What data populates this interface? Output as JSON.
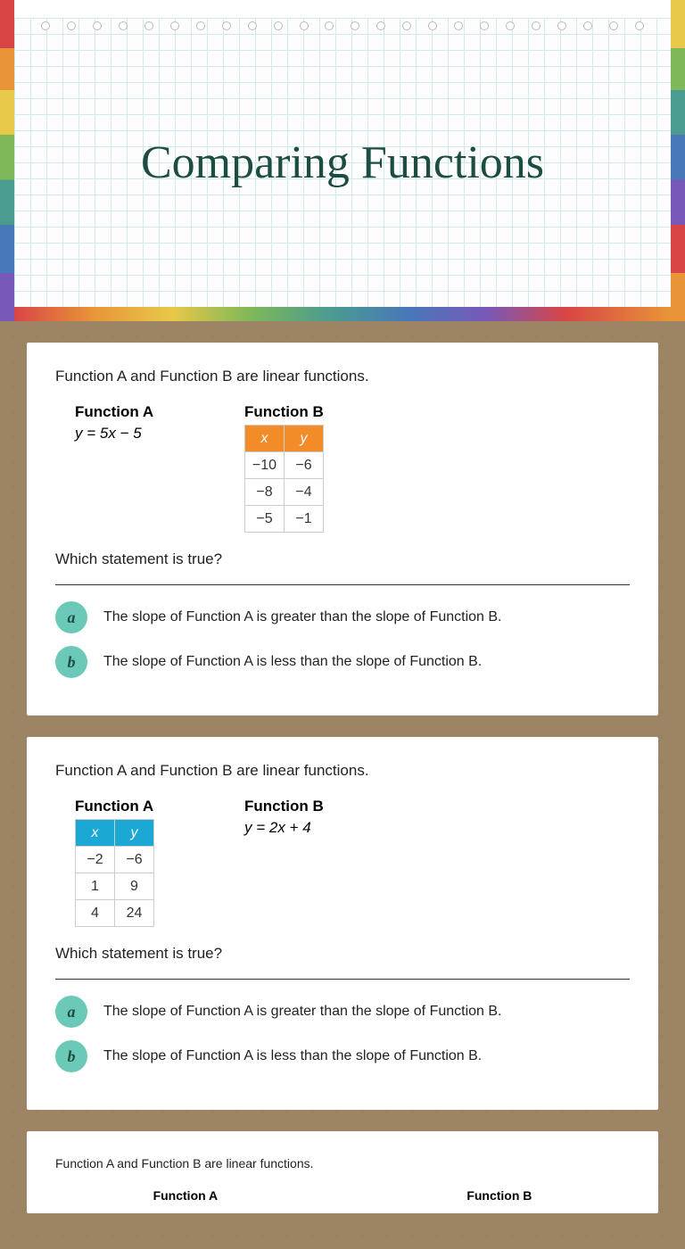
{
  "title": "Comparing Functions",
  "q1": {
    "prompt": "Function A and Function B are linear functions.",
    "funcA": {
      "title": "Function A",
      "eq": "y = 5x − 5"
    },
    "funcB": {
      "title": "Function B",
      "headers": [
        "x",
        "y"
      ],
      "rows": [
        [
          "−10",
          "−6"
        ],
        [
          "−8",
          "−4"
        ],
        [
          "−5",
          "−1"
        ]
      ]
    },
    "which": "Which statement is true?",
    "choices": {
      "a": {
        "letter": "a",
        "text": "The slope of Function A is greater than the slope of Function B."
      },
      "b": {
        "letter": "b",
        "text": "The slope of Function A is less than the slope of Function B."
      }
    }
  },
  "q2": {
    "prompt": "Function A and Function B are linear functions.",
    "funcA": {
      "title": "Function A",
      "headers": [
        "x",
        "y"
      ],
      "rows": [
        [
          "−2",
          "−6"
        ],
        [
          "1",
          "9"
        ],
        [
          "4",
          "24"
        ]
      ]
    },
    "funcB": {
      "title": "Function B",
      "eq": "y = 2x + 4"
    },
    "which": "Which statement is true?",
    "choices": {
      "a": {
        "letter": "a",
        "text": "The slope of Function A is greater than the slope of Function B."
      },
      "b": {
        "letter": "b",
        "text": "The slope of Function A is less than the slope of Function B."
      }
    }
  },
  "q3": {
    "prompt": "Function A and Function B are linear functions.",
    "funcA": {
      "title": "Function A"
    },
    "funcB": {
      "title": "Function B"
    }
  }
}
